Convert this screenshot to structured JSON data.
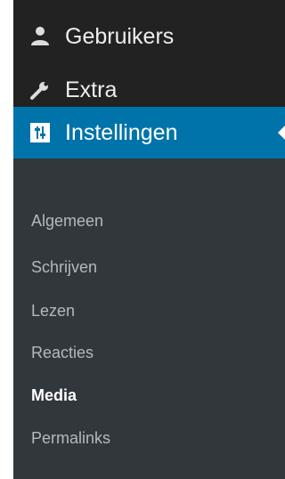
{
  "menu": {
    "items": [
      {
        "label": "Gebruikers",
        "icon": "users-icon"
      },
      {
        "label": "Extra",
        "icon": "wrench-icon"
      },
      {
        "label": "Instellingen",
        "icon": "settings-sliders-icon",
        "current": true
      }
    ],
    "submenu": [
      {
        "label": "Algemeen"
      },
      {
        "label": "Schrijven"
      },
      {
        "label": "Lezen"
      },
      {
        "label": "Reacties"
      },
      {
        "label": "Media",
        "current": true
      },
      {
        "label": "Permalinks"
      }
    ]
  },
  "colors": {
    "sidebar_bg": "#222222",
    "submenu_bg": "#32373c",
    "accent": "#0073aa",
    "text": "#eeeeee",
    "sub_text": "#b4b9be",
    "sub_text_current": "#ffffff"
  }
}
